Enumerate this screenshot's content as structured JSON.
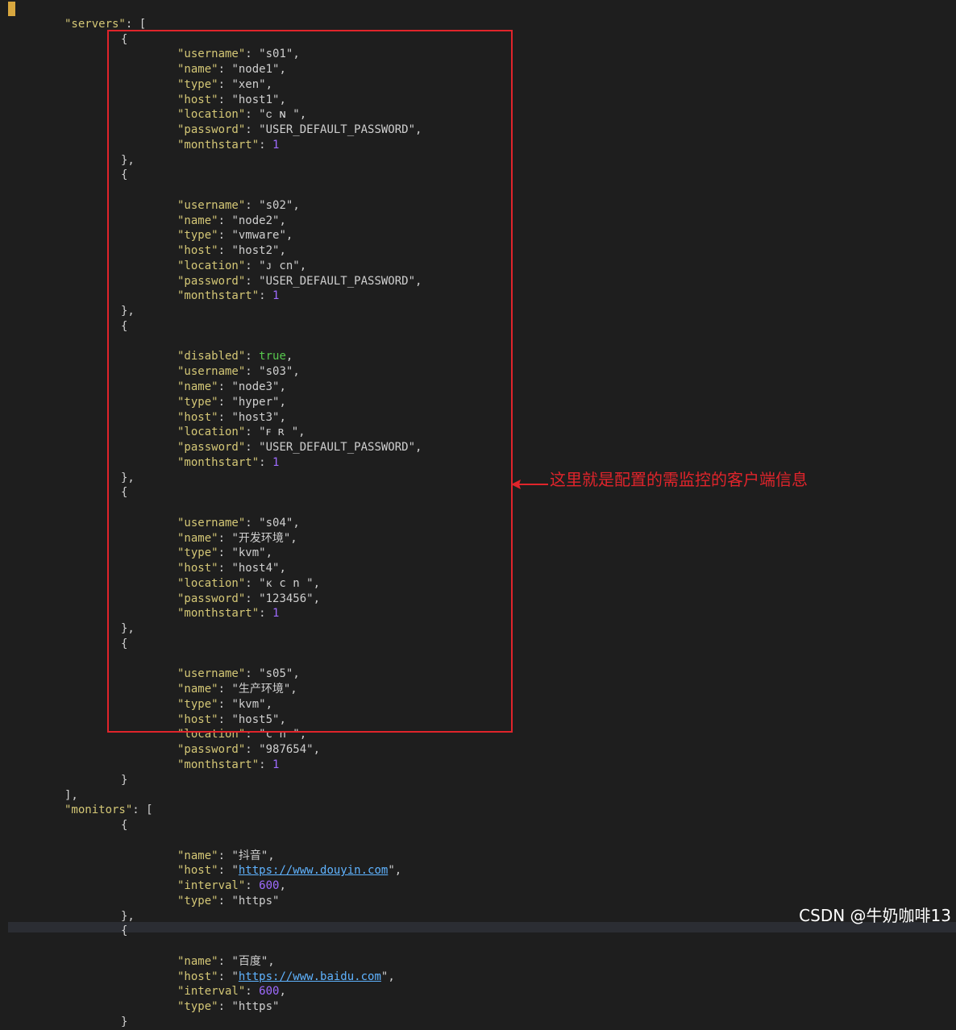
{
  "editor": {
    "lines": [
      {
        "indent": 0,
        "tokens": [
          [
            "bracket",
            "{"
          ]
        ]
      },
      {
        "indent": 1,
        "tokens": [
          [
            "key",
            "\"servers\""
          ],
          [
            "punc",
            ": ["
          ]
        ]
      },
      {
        "indent": 2,
        "tokens": [
          [
            "punc",
            "{"
          ]
        ]
      },
      {
        "indent": 3,
        "tokens": [
          [
            "key",
            "\"username\""
          ],
          [
            "punc",
            ": "
          ],
          [
            "str",
            "\"s01\""
          ],
          [
            "punc",
            ","
          ]
        ]
      },
      {
        "indent": 3,
        "tokens": [
          [
            "key",
            "\"name\""
          ],
          [
            "punc",
            ": "
          ],
          [
            "str",
            "\"node1\""
          ],
          [
            "punc",
            ","
          ]
        ]
      },
      {
        "indent": 3,
        "tokens": [
          [
            "key",
            "\"type\""
          ],
          [
            "punc",
            ": "
          ],
          [
            "str",
            "\"xen\""
          ],
          [
            "punc",
            ","
          ]
        ]
      },
      {
        "indent": 3,
        "tokens": [
          [
            "key",
            "\"host\""
          ],
          [
            "punc",
            ": "
          ],
          [
            "str",
            "\"host1\""
          ],
          [
            "punc",
            ","
          ]
        ]
      },
      {
        "indent": 3,
        "tokens": [
          [
            "key",
            "\"location\""
          ],
          [
            "punc",
            ": "
          ],
          [
            "str",
            "\"ᴄ ɴ \""
          ],
          [
            "punc",
            ","
          ]
        ]
      },
      {
        "indent": 3,
        "tokens": [
          [
            "key",
            "\"password\""
          ],
          [
            "punc",
            ": "
          ],
          [
            "str",
            "\"USER_DEFAULT_PASSWORD\""
          ],
          [
            "punc",
            ","
          ]
        ]
      },
      {
        "indent": 3,
        "tokens": [
          [
            "key",
            "\"monthstart\""
          ],
          [
            "punc",
            ": "
          ],
          [
            "num",
            "1"
          ]
        ]
      },
      {
        "indent": 2,
        "tokens": [
          [
            "punc",
            "},"
          ]
        ]
      },
      {
        "indent": 2,
        "tokens": [
          [
            "punc",
            "{"
          ]
        ]
      },
      {
        "indent": 3,
        "tokens": []
      },
      {
        "indent": 3,
        "tokens": [
          [
            "key",
            "\"username\""
          ],
          [
            "punc",
            ": "
          ],
          [
            "str",
            "\"s02\""
          ],
          [
            "punc",
            ","
          ]
        ]
      },
      {
        "indent": 3,
        "tokens": [
          [
            "key",
            "\"name\""
          ],
          [
            "punc",
            ": "
          ],
          [
            "str",
            "\"node2\""
          ],
          [
            "punc",
            ","
          ]
        ]
      },
      {
        "indent": 3,
        "tokens": [
          [
            "key",
            "\"type\""
          ],
          [
            "punc",
            ": "
          ],
          [
            "str",
            "\"vmware\""
          ],
          [
            "punc",
            ","
          ]
        ]
      },
      {
        "indent": 3,
        "tokens": [
          [
            "key",
            "\"host\""
          ],
          [
            "punc",
            ": "
          ],
          [
            "str",
            "\"host2\""
          ],
          [
            "punc",
            ","
          ]
        ]
      },
      {
        "indent": 3,
        "tokens": [
          [
            "key",
            "\"location\""
          ],
          [
            "punc",
            ": "
          ],
          [
            "str",
            "\"ᴊ cn\""
          ],
          [
            "punc",
            ","
          ]
        ]
      },
      {
        "indent": 3,
        "tokens": [
          [
            "key",
            "\"password\""
          ],
          [
            "punc",
            ": "
          ],
          [
            "str",
            "\"USER_DEFAULT_PASSWORD\""
          ],
          [
            "punc",
            ","
          ]
        ]
      },
      {
        "indent": 3,
        "tokens": [
          [
            "key",
            "\"monthstart\""
          ],
          [
            "punc",
            ": "
          ],
          [
            "num",
            "1"
          ]
        ]
      },
      {
        "indent": 2,
        "tokens": [
          [
            "punc",
            "},"
          ]
        ]
      },
      {
        "indent": 2,
        "tokens": [
          [
            "punc",
            "{"
          ]
        ]
      },
      {
        "indent": 3,
        "tokens": []
      },
      {
        "indent": 3,
        "tokens": [
          [
            "key",
            "\"disabled\""
          ],
          [
            "punc",
            ": "
          ],
          [
            "bool",
            "true"
          ],
          [
            "punc",
            ","
          ]
        ]
      },
      {
        "indent": 3,
        "tokens": [
          [
            "key",
            "\"username\""
          ],
          [
            "punc",
            ": "
          ],
          [
            "str",
            "\"s03\""
          ],
          [
            "punc",
            ","
          ]
        ]
      },
      {
        "indent": 3,
        "tokens": [
          [
            "key",
            "\"name\""
          ],
          [
            "punc",
            ": "
          ],
          [
            "str",
            "\"node3\""
          ],
          [
            "punc",
            ","
          ]
        ]
      },
      {
        "indent": 3,
        "tokens": [
          [
            "key",
            "\"type\""
          ],
          [
            "punc",
            ": "
          ],
          [
            "str",
            "\"hyper\""
          ],
          [
            "punc",
            ","
          ]
        ]
      },
      {
        "indent": 3,
        "tokens": [
          [
            "key",
            "\"host\""
          ],
          [
            "punc",
            ": "
          ],
          [
            "str",
            "\"host3\""
          ],
          [
            "punc",
            ","
          ]
        ]
      },
      {
        "indent": 3,
        "tokens": [
          [
            "key",
            "\"location\""
          ],
          [
            "punc",
            ": "
          ],
          [
            "str",
            "\"ꜰ ʀ \""
          ],
          [
            "punc",
            ","
          ]
        ]
      },
      {
        "indent": 3,
        "tokens": [
          [
            "key",
            "\"password\""
          ],
          [
            "punc",
            ": "
          ],
          [
            "str",
            "\"USER_DEFAULT_PASSWORD\""
          ],
          [
            "punc",
            ","
          ]
        ]
      },
      {
        "indent": 3,
        "tokens": [
          [
            "key",
            "\"monthstart\""
          ],
          [
            "punc",
            ": "
          ],
          [
            "num",
            "1"
          ]
        ]
      },
      {
        "indent": 2,
        "tokens": [
          [
            "punc",
            "},"
          ]
        ]
      },
      {
        "indent": 2,
        "tokens": [
          [
            "punc",
            "{"
          ]
        ]
      },
      {
        "indent": 3,
        "tokens": []
      },
      {
        "indent": 3,
        "tokens": [
          [
            "key",
            "\"username\""
          ],
          [
            "punc",
            ": "
          ],
          [
            "str",
            "\"s04\""
          ],
          [
            "punc",
            ","
          ]
        ]
      },
      {
        "indent": 3,
        "tokens": [
          [
            "key",
            "\"name\""
          ],
          [
            "punc",
            ": "
          ],
          [
            "str",
            "\"开发环境\""
          ],
          [
            "punc",
            ","
          ]
        ]
      },
      {
        "indent": 3,
        "tokens": [
          [
            "key",
            "\"type\""
          ],
          [
            "punc",
            ": "
          ],
          [
            "str",
            "\"kvm\""
          ],
          [
            "punc",
            ","
          ]
        ]
      },
      {
        "indent": 3,
        "tokens": [
          [
            "key",
            "\"host\""
          ],
          [
            "punc",
            ": "
          ],
          [
            "str",
            "\"host4\""
          ],
          [
            "punc",
            ","
          ]
        ]
      },
      {
        "indent": 3,
        "tokens": [
          [
            "key",
            "\"location\""
          ],
          [
            "punc",
            ": "
          ],
          [
            "str",
            "\"ᴋ c n \""
          ],
          [
            "punc",
            ","
          ]
        ]
      },
      {
        "indent": 3,
        "tokens": [
          [
            "key",
            "\"password\""
          ],
          [
            "punc",
            ": "
          ],
          [
            "str",
            "\"123456\""
          ],
          [
            "punc",
            ","
          ]
        ]
      },
      {
        "indent": 3,
        "tokens": [
          [
            "key",
            "\"monthstart\""
          ],
          [
            "punc",
            ": "
          ],
          [
            "num",
            "1"
          ]
        ]
      },
      {
        "indent": 2,
        "tokens": [
          [
            "punc",
            "},"
          ]
        ]
      },
      {
        "indent": 2,
        "tokens": [
          [
            "punc",
            "{"
          ]
        ]
      },
      {
        "indent": 3,
        "tokens": []
      },
      {
        "indent": 3,
        "tokens": [
          [
            "key",
            "\"username\""
          ],
          [
            "punc",
            ": "
          ],
          [
            "str",
            "\"s05\""
          ],
          [
            "punc",
            ","
          ]
        ]
      },
      {
        "indent": 3,
        "tokens": [
          [
            "key",
            "\"name\""
          ],
          [
            "punc",
            ": "
          ],
          [
            "str",
            "\"生产环境\""
          ],
          [
            "punc",
            ","
          ]
        ]
      },
      {
        "indent": 3,
        "tokens": [
          [
            "key",
            "\"type\""
          ],
          [
            "punc",
            ": "
          ],
          [
            "str",
            "\"kvm\""
          ],
          [
            "punc",
            ","
          ]
        ]
      },
      {
        "indent": 3,
        "tokens": [
          [
            "key",
            "\"host\""
          ],
          [
            "punc",
            ": "
          ],
          [
            "str",
            "\"host5\""
          ],
          [
            "punc",
            ","
          ]
        ]
      },
      {
        "indent": 3,
        "tokens": [
          [
            "key",
            "\"location\""
          ],
          [
            "punc",
            ": "
          ],
          [
            "str",
            "\"c n \""
          ],
          [
            "punc",
            ","
          ]
        ]
      },
      {
        "indent": 3,
        "tokens": [
          [
            "key",
            "\"password\""
          ],
          [
            "punc",
            ": "
          ],
          [
            "str",
            "\"987654\""
          ],
          [
            "punc",
            ","
          ]
        ]
      },
      {
        "indent": 3,
        "tokens": [
          [
            "key",
            "\"monthstart\""
          ],
          [
            "punc",
            ": "
          ],
          [
            "num",
            "1"
          ]
        ]
      },
      {
        "indent": 2,
        "tokens": [
          [
            "punc",
            "}"
          ]
        ]
      },
      {
        "indent": 1,
        "tokens": [
          [
            "punc",
            "],"
          ]
        ]
      },
      {
        "indent": 1,
        "tokens": [
          [
            "key",
            "\"monitors\""
          ],
          [
            "punc",
            ": ["
          ]
        ]
      },
      {
        "indent": 2,
        "tokens": [
          [
            "punc",
            "{"
          ]
        ]
      },
      {
        "indent": 3,
        "tokens": []
      },
      {
        "indent": 3,
        "tokens": [
          [
            "key",
            "\"name\""
          ],
          [
            "punc",
            ": "
          ],
          [
            "str",
            "\"抖音\""
          ],
          [
            "punc",
            ","
          ]
        ]
      },
      {
        "indent": 3,
        "tokens": [
          [
            "key",
            "\"host\""
          ],
          [
            "punc",
            ": "
          ],
          [
            "str",
            "\""
          ],
          [
            "url",
            "https://www.douyin.com"
          ],
          [
            "str",
            "\""
          ],
          [
            "punc",
            ","
          ]
        ]
      },
      {
        "indent": 3,
        "tokens": [
          [
            "key",
            "\"interval\""
          ],
          [
            "punc",
            ": "
          ],
          [
            "num",
            "600"
          ],
          [
            "punc",
            ","
          ]
        ]
      },
      {
        "indent": 3,
        "tokens": [
          [
            "key",
            "\"type\""
          ],
          [
            "punc",
            ": "
          ],
          [
            "str",
            "\"https\""
          ]
        ]
      },
      {
        "indent": 2,
        "tokens": [
          [
            "punc",
            "},"
          ]
        ]
      },
      {
        "indent": 2,
        "tokens": [
          [
            "punc",
            "{"
          ]
        ]
      },
      {
        "indent": 3,
        "tokens": []
      },
      {
        "indent": 3,
        "tokens": [
          [
            "key",
            "\"name\""
          ],
          [
            "punc",
            ": "
          ],
          [
            "str",
            "\"百度\""
          ],
          [
            "punc",
            ","
          ]
        ]
      },
      {
        "indent": 3,
        "tokens": [
          [
            "key",
            "\"host\""
          ],
          [
            "punc",
            ": "
          ],
          [
            "str",
            "\""
          ],
          [
            "url",
            "https://www.baidu.com"
          ],
          [
            "str",
            "\""
          ],
          [
            "punc",
            ","
          ]
        ]
      },
      {
        "indent": 3,
        "tokens": [
          [
            "key",
            "\"interval\""
          ],
          [
            "punc",
            ": "
          ],
          [
            "num",
            "600"
          ],
          [
            "punc",
            ","
          ]
        ]
      },
      {
        "indent": 3,
        "tokens": [
          [
            "key",
            "\"type\""
          ],
          [
            "punc",
            ": "
          ],
          [
            "str",
            "\"https\""
          ]
        ]
      },
      {
        "indent": 2,
        "tokens": [
          [
            "punc",
            "}"
          ]
        ]
      }
    ]
  },
  "annotation": {
    "text": "这里就是配置的需监控的客户端信息",
    "color": "#e0242b"
  },
  "watermark": "CSDN @牛奶咖啡13",
  "colors": {
    "background": "#1e1e1e",
    "key": "#d4c776",
    "number": "#9e6bff",
    "boolean": "#57c84d",
    "url": "#5fb3ff"
  }
}
